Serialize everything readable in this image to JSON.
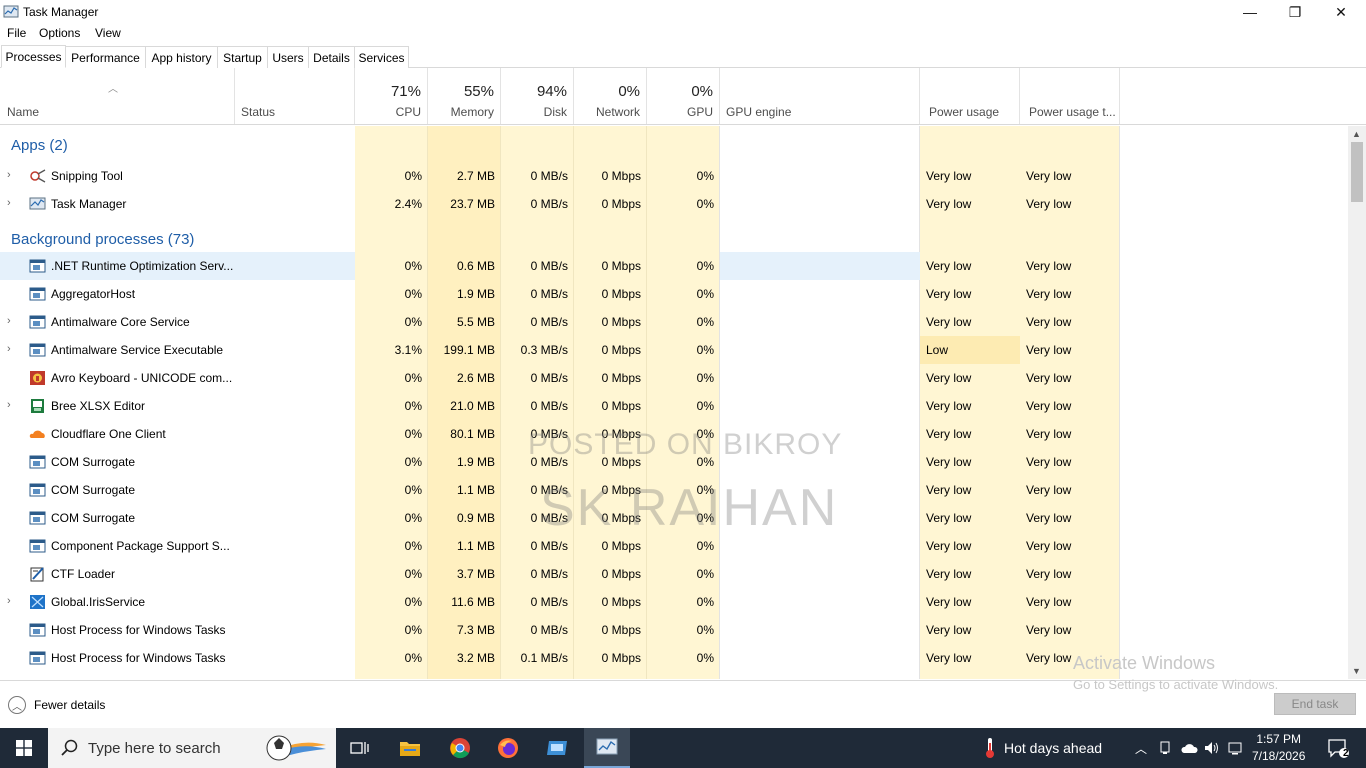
{
  "window": {
    "title": "Task Manager",
    "minimize": "—",
    "maximize": "❐",
    "close": "✕"
  },
  "menu": {
    "file": "File",
    "options": "Options",
    "view": "View"
  },
  "tabs": [
    "Processes",
    "Performance",
    "App history",
    "Startup",
    "Users",
    "Details",
    "Services"
  ],
  "columns": {
    "name": "Name",
    "status": "Status",
    "cpu_pct": "71%",
    "cpu": "CPU",
    "memory_pct": "55%",
    "memory": "Memory",
    "disk_pct": "94%",
    "disk": "Disk",
    "network_pct": "0%",
    "network": "Network",
    "gpu_pct": "0%",
    "gpu": "GPU",
    "gpu_engine": "GPU engine",
    "power": "Power usage",
    "power_trend": "Power usage t..."
  },
  "groups": {
    "apps": "Apps (2)",
    "background": "Background processes (73)"
  },
  "apps": [
    {
      "name": "Snipping Tool",
      "cpu": "0%",
      "memory": "2.7 MB",
      "disk": "0 MB/s",
      "network": "0 Mbps",
      "gpu": "0%",
      "power": "Very low",
      "power_trend": "Very low",
      "expand": true,
      "icon": "snipping-tool-icon"
    },
    {
      "name": "Task Manager",
      "cpu": "2.4%",
      "memory": "23.7 MB",
      "disk": "0 MB/s",
      "network": "0 Mbps",
      "gpu": "0%",
      "power": "Very low",
      "power_trend": "Very low",
      "expand": true,
      "icon": "task-manager-icon"
    }
  ],
  "background": [
    {
      "name": ".NET Runtime Optimization Serv...",
      "cpu": "0%",
      "memory": "0.6 MB",
      "disk": "0 MB/s",
      "network": "0 Mbps",
      "gpu": "0%",
      "power": "Very low",
      "power_trend": "Very low",
      "expand": false,
      "icon": "service-window-icon"
    },
    {
      "name": "AggregatorHost",
      "cpu": "0%",
      "memory": "1.9 MB",
      "disk": "0 MB/s",
      "network": "0 Mbps",
      "gpu": "0%",
      "power": "Very low",
      "power_trend": "Very low",
      "expand": false,
      "icon": "service-window-icon"
    },
    {
      "name": "Antimalware Core Service",
      "cpu": "0%",
      "memory": "5.5 MB",
      "disk": "0 MB/s",
      "network": "0 Mbps",
      "gpu": "0%",
      "power": "Very low",
      "power_trend": "Very low",
      "expand": true,
      "icon": "service-window-icon"
    },
    {
      "name": "Antimalware Service Executable",
      "cpu": "3.1%",
      "memory": "199.1 MB",
      "disk": "0.3 MB/s",
      "network": "0 Mbps",
      "gpu": "0%",
      "power": "Low",
      "power_trend": "Very low",
      "expand": true,
      "icon": "service-window-icon"
    },
    {
      "name": "Avro Keyboard - UNICODE com...",
      "cpu": "0%",
      "memory": "2.6 MB",
      "disk": "0 MB/s",
      "network": "0 Mbps",
      "gpu": "0%",
      "power": "Very low",
      "power_trend": "Very low",
      "expand": false,
      "icon": "avro-keyboard-icon"
    },
    {
      "name": "Bree XLSX Editor",
      "cpu": "0%",
      "memory": "21.0 MB",
      "disk": "0 MB/s",
      "network": "0 Mbps",
      "gpu": "0%",
      "power": "Very low",
      "power_trend": "Very low",
      "expand": true,
      "icon": "xlsx-editor-icon"
    },
    {
      "name": "Cloudflare One Client",
      "cpu": "0%",
      "memory": "80.1 MB",
      "disk": "0 MB/s",
      "network": "0 Mbps",
      "gpu": "0%",
      "power": "Very low",
      "power_trend": "Very low",
      "expand": false,
      "icon": "cloudflare-icon"
    },
    {
      "name": "COM Surrogate",
      "cpu": "0%",
      "memory": "1.9 MB",
      "disk": "0 MB/s",
      "network": "0 Mbps",
      "gpu": "0%",
      "power": "Very low",
      "power_trend": "Very low",
      "expand": false,
      "icon": "service-window-icon"
    },
    {
      "name": "COM Surrogate",
      "cpu": "0%",
      "memory": "1.1 MB",
      "disk": "0 MB/s",
      "network": "0 Mbps",
      "gpu": "0%",
      "power": "Very low",
      "power_trend": "Very low",
      "expand": false,
      "icon": "service-window-icon"
    },
    {
      "name": "COM Surrogate",
      "cpu": "0%",
      "memory": "0.9 MB",
      "disk": "0 MB/s",
      "network": "0 Mbps",
      "gpu": "0%",
      "power": "Very low",
      "power_trend": "Very low",
      "expand": false,
      "icon": "service-window-icon"
    },
    {
      "name": "Component Package Support S...",
      "cpu": "0%",
      "memory": "1.1 MB",
      "disk": "0 MB/s",
      "network": "0 Mbps",
      "gpu": "0%",
      "power": "Very low",
      "power_trend": "Very low",
      "expand": false,
      "icon": "service-window-icon"
    },
    {
      "name": "CTF Loader",
      "cpu": "0%",
      "memory": "3.7 MB",
      "disk": "0 MB/s",
      "network": "0 Mbps",
      "gpu": "0%",
      "power": "Very low",
      "power_trend": "Very low",
      "expand": false,
      "icon": "ctf-loader-icon"
    },
    {
      "name": "Global.IrisService",
      "cpu": "0%",
      "memory": "11.6 MB",
      "disk": "0 MB/s",
      "network": "0 Mbps",
      "gpu": "0%",
      "power": "Very low",
      "power_trend": "Very low",
      "expand": true,
      "icon": "iris-service-icon"
    },
    {
      "name": "Host Process for Windows Tasks",
      "cpu": "0%",
      "memory": "7.3 MB",
      "disk": "0 MB/s",
      "network": "0 Mbps",
      "gpu": "0%",
      "power": "Very low",
      "power_trend": "Very low",
      "expand": false,
      "icon": "service-window-icon"
    },
    {
      "name": "Host Process for Windows Tasks",
      "cpu": "0%",
      "memory": "3.2 MB",
      "disk": "0.1 MB/s",
      "network": "0 Mbps",
      "gpu": "0%",
      "power": "Very low",
      "power_trend": "Very low",
      "expand": false,
      "icon": "service-window-icon"
    }
  ],
  "footer": {
    "fewer_details": "Fewer details",
    "end_task": "End task"
  },
  "overlay": {
    "activate_title": "Activate Windows",
    "activate_sub": "Go to Settings to activate Windows.",
    "watermark1": "POSTED ON BIKROY",
    "watermark2": "SK RAIHAN"
  },
  "taskbar": {
    "search_placeholder": "Type here to search",
    "weather": "Hot days ahead",
    "time": "1:57 PM",
    "date": "7/18/2026",
    "notifications": "2"
  },
  "colors": {
    "heat_light": "#fff9e3",
    "heat_med": "#fff4c4",
    "heat_strong": "#fde9a8",
    "selection": "#e5f1fb",
    "group_text": "#1f5ea8",
    "taskbar": "#1f2a38"
  }
}
